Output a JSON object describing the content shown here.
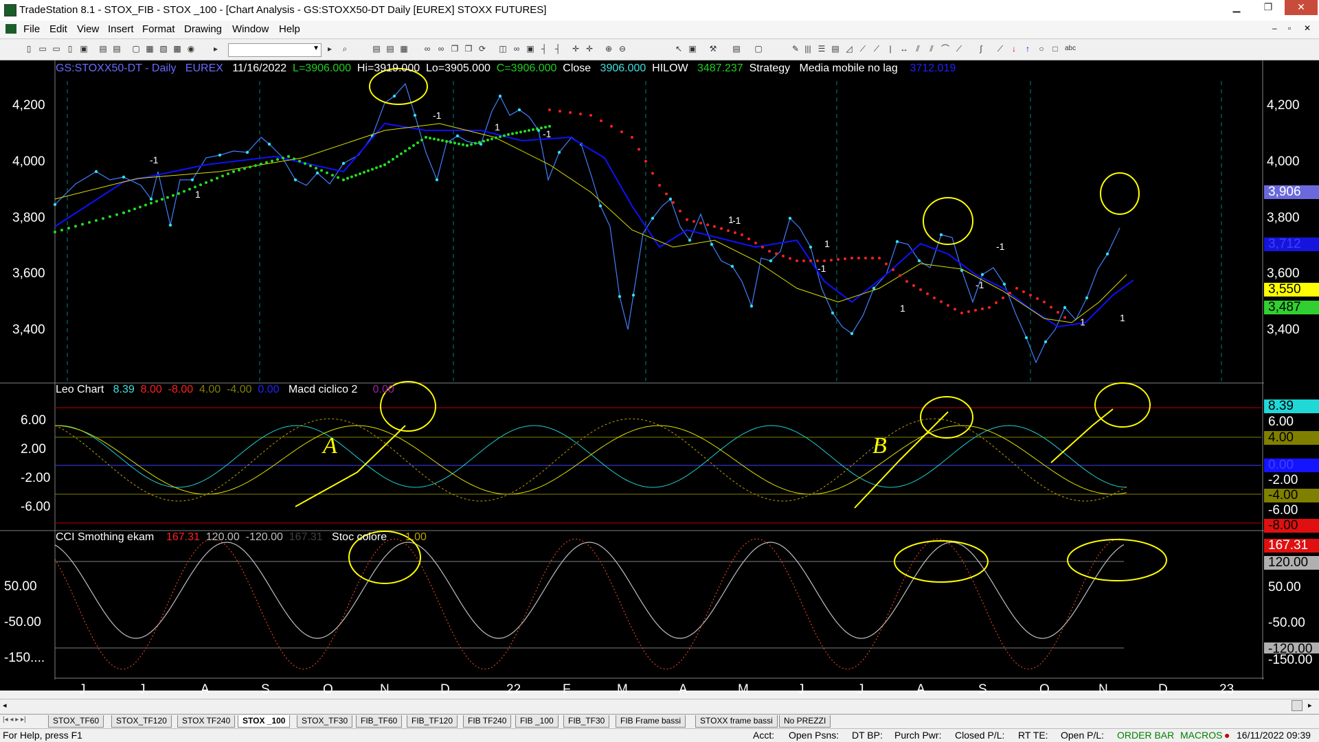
{
  "window": {
    "title": "TradeStation 8.1 - STOX_FIB - STOX _100 - [Chart Analysis - GS:STOXX50-DT  Daily  [EUREX] STOXX FUTURES]",
    "minimize": "▁",
    "maximize": "❐",
    "close": "✕",
    "mdi_minimize": "–",
    "mdi_restore": "▫",
    "mdi_close": "✕"
  },
  "menu": [
    "File",
    "Edit",
    "View",
    "Insert",
    "Format",
    "Drawing",
    "Window",
    "Help"
  ],
  "header": {
    "symbol": "GS:STOXX50-DT - Daily",
    "exchange": "EUREX",
    "date": "11/16/2022",
    "last": "L=3906.000",
    "hi": "Hi=3919.000",
    "lo": "Lo=3905.000",
    "close_c": "C=3906.000",
    "close_label": "Close",
    "close_value": "3906.000",
    "hilow_label": "HILOW",
    "hilow_value": "3487.237",
    "strategy_label": "Strategy",
    "media_label": "Media mobile no lag",
    "media_value": "3712.019"
  },
  "price_panel": {
    "y_ticks": [
      "4,200",
      "4,000",
      "3,800",
      "3,600",
      "3,400"
    ],
    "badges": [
      {
        "text": "3,906",
        "bg": "#6a6adc",
        "fg": "#ffffff"
      },
      {
        "text": "3,712",
        "bg": "#1414dc",
        "fg": "#4040ff"
      },
      {
        "text": "3,550",
        "bg": "#ffff00",
        "fg": "#000000"
      },
      {
        "text": "3,487",
        "bg": "#30d030",
        "fg": "#000000"
      }
    ],
    "markers": [
      "-1",
      "1",
      "-1",
      "1",
      "-1",
      "1",
      "-1",
      "1",
      "-1",
      "1",
      "-1",
      "1",
      "-1",
      "1"
    ]
  },
  "leo_panel": {
    "title": "Leo Chart",
    "values": [
      {
        "text": "8.39",
        "color": "#40e0e0"
      },
      {
        "text": "8.00",
        "color": "#ff2020"
      },
      {
        "text": "-8.00",
        "color": "#ff2020"
      },
      {
        "text": "4.00",
        "color": "#808000"
      },
      {
        "text": "-4.00",
        "color": "#808000"
      },
      {
        "text": "0.00",
        "color": "#2020ff"
      }
    ],
    "macd_label": "Macd ciclico 2",
    "macd_value": "0.00",
    "y_ticks": [
      "6.00",
      "2.00",
      "-2.00",
      "-6.00"
    ],
    "badges": [
      {
        "text": "8.39",
        "bg": "#20d8d8",
        "fg": "#000000"
      },
      {
        "text": "6.00",
        "bg": "#000000",
        "fg": "#ffffff"
      },
      {
        "text": "4.00",
        "bg": "#808000",
        "fg": "#000000"
      },
      {
        "text": "0.00",
        "bg": "#1414ff",
        "fg": "#4040ff"
      },
      {
        "text": "-2.00",
        "bg": "#000000",
        "fg": "#ffffff"
      },
      {
        "text": "-4.00",
        "bg": "#808000",
        "fg": "#000000"
      },
      {
        "text": "-6.00",
        "bg": "#000000",
        "fg": "#ffffff"
      },
      {
        "text": "-8.00",
        "bg": "#e01010",
        "fg": "#000000"
      }
    ]
  },
  "cci_panel": {
    "title": "CCI Smothing ekam",
    "values": [
      {
        "text": "167.31",
        "color": "#ff2020"
      },
      {
        "text": "120.00",
        "color": "#c0c0c0"
      },
      {
        "text": "-120.00",
        "color": "#c0c0c0"
      },
      {
        "text": "167.31",
        "color": "#404040"
      }
    ],
    "stoc_label": "Stoc colore",
    "stoc_value": "1.00",
    "y_ticks": [
      "50.00",
      "-50.00",
      "-150...."
    ],
    "badges": [
      {
        "text": "167.31",
        "bg": "#e01010",
        "fg": "#ffffff"
      },
      {
        "text": "120.00",
        "bg": "#b0b0b0",
        "fg": "#000000"
      },
      {
        "text": "50.00",
        "bg": "#000000",
        "fg": "#ffffff"
      },
      {
        "text": "-50.00",
        "bg": "#000000",
        "fg": "#ffffff"
      },
      {
        "text": "-120.00",
        "bg": "#b0b0b0",
        "fg": "#000000"
      },
      {
        "text": "-150.00",
        "bg": "#000000",
        "fg": "#ffffff"
      }
    ]
  },
  "annotations": {
    "A": "A",
    "B": "B"
  },
  "x_axis": [
    "J",
    "J",
    "A",
    "S",
    "O",
    "N",
    "D",
    "22",
    "F",
    "M",
    "A",
    "M",
    "J",
    "J",
    "A",
    "S",
    "O",
    "N",
    "D",
    "23"
  ],
  "tabs": [
    {
      "label": "STOX_TF60",
      "active": false
    },
    {
      "label": "STOX_TF120",
      "active": false
    },
    {
      "label": "STOX TF240",
      "active": false
    },
    {
      "label": "STOX _100",
      "active": true
    },
    {
      "label": "STOX_TF30",
      "active": false
    },
    {
      "label": "FIB_TF60",
      "active": false
    },
    {
      "label": "FIB_TF120",
      "active": false
    },
    {
      "label": "FIB TF240",
      "active": false
    },
    {
      "label": "FIB _100",
      "active": false
    },
    {
      "label": "FIB_TF30",
      "active": false
    },
    {
      "label": "FIB Frame bassi",
      "active": false
    },
    {
      "label": "STOXX frame bassi",
      "active": false
    },
    {
      "label": "No PREZZI",
      "active": false
    }
  ],
  "status": {
    "help": "For Help, press F1",
    "acct": "Acct:",
    "open_psns": "Open Psns:",
    "dt_bp": "DT BP:",
    "purch_pwr": "Purch Pwr:",
    "closed_pl": "Closed P/L:",
    "rt_te": "RT TE:",
    "open_pl": "Open P/L:",
    "order_bar": "ORDER BAR",
    "macros": "MACROS",
    "datetime": "16/11/2022 09:39"
  }
}
